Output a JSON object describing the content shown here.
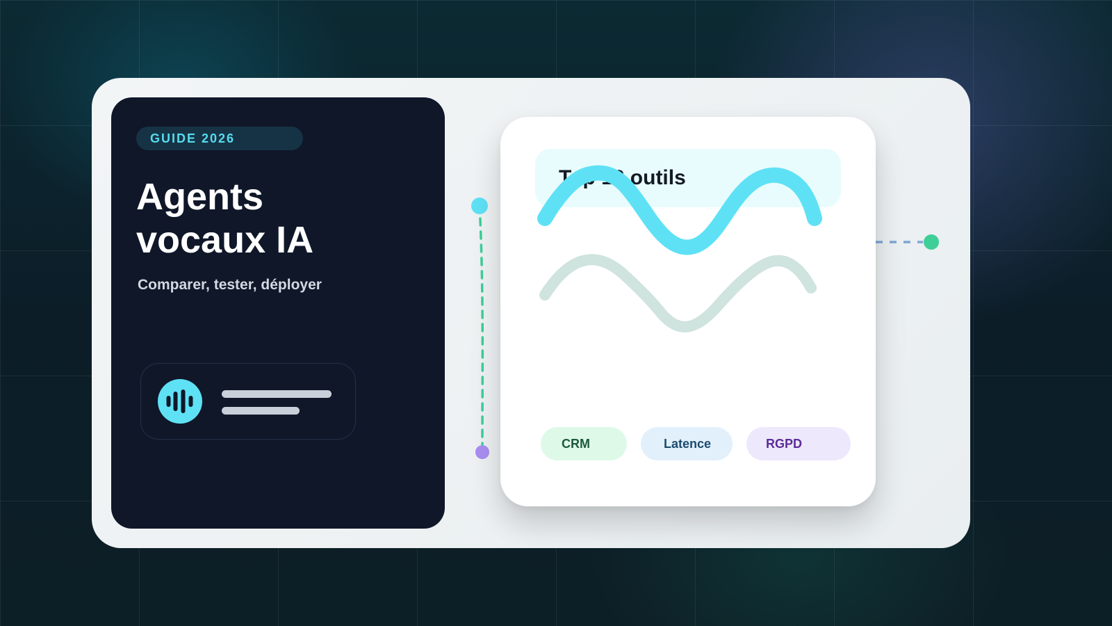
{
  "badge": {
    "label": "GUIDE 2026"
  },
  "hero": {
    "title_line1": "Agents",
    "title_line2": "vocaux IA",
    "subtitle": "Comparer, tester, déployer"
  },
  "voice_card": {
    "icon": "voice-waveform-icon"
  },
  "tools_card": {
    "title": "Top 12 outils",
    "tags": [
      {
        "label": "CRM",
        "color": "#1c5a3a",
        "background": "#dff9e8"
      },
      {
        "label": "Latence",
        "color": "#1b4b6e",
        "background": "#e2f0fb"
      },
      {
        "label": "RGPD",
        "color": "#5b2c98",
        "background": "#ede8fb"
      }
    ]
  },
  "colors": {
    "accent_cyan": "#5fe1f5",
    "accent_green": "#3ecf98",
    "accent_purple": "#a98ef0",
    "dark_panel": "#0f1729",
    "wave_secondary": "#cfe3df"
  }
}
